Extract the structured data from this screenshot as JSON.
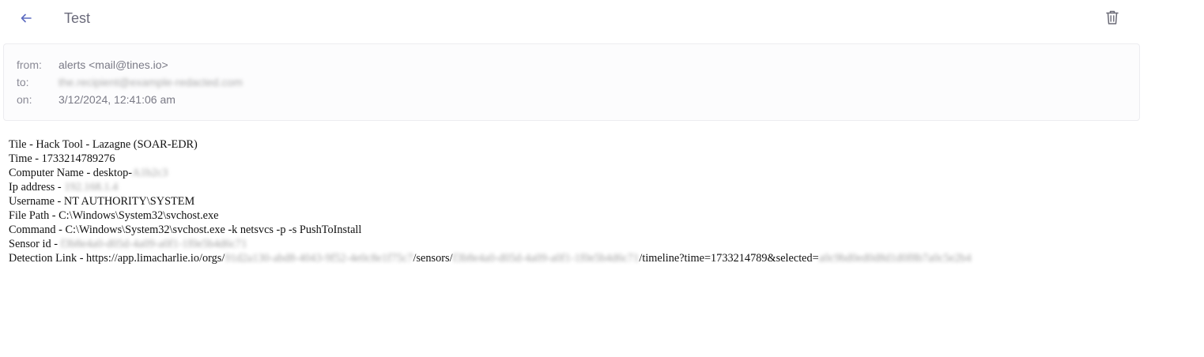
{
  "header": {
    "title": "Test",
    "back_icon": "arrow-left-icon",
    "delete_icon": "trash-icon",
    "accent_color": "#5c6bc0"
  },
  "meta": {
    "from_label": "from:",
    "from_value": "alerts <mail@tines.io>",
    "to_label": "to:",
    "to_value_redacted": "the.recipient@example-redacted.com",
    "on_label": "on:",
    "on_value": "3/12/2024, 12:41:06 am"
  },
  "body": {
    "tile": "Tile - Hack Tool - Lazagne (SOAR-EDR)",
    "time": "Time - 1733214789276",
    "computer_prefix": "Computer Name - desktop-",
    "computer_redacted": "A1b2c3",
    "ip_prefix": "Ip address - ",
    "ip_redacted": "192.168.1.4",
    "username": "Username - NT AUTHORITY\\SYSTEM",
    "file_path": "File Path - C:\\Windows\\System32\\svchost.exe",
    "command": "Command - C:\\Windows\\System32\\svchost.exe -k netsvcs -p -s PushToInstall",
    "sensor_prefix": "Sensor id - ",
    "sensor_redacted": "f3b8e4a0-d05d-4a09-a0f1-1f0e5b4d6c71",
    "link_prefix": "Detection Link - https://app.limacharlie.io/orgs/",
    "link_org_redacted": "91d2a130-abd8-4043-9f52-4e0c8e1f75c7",
    "link_sensors": "/sensors/",
    "link_sensor_redacted": "f3b8e4a0-d05d-4a09-a0f1-1f0e5b4d6c71",
    "link_suffix": "/timeline?time=1733214789&selected=",
    "link_selected_redacted": "a0c9bd0ed0d8d1d0f8b7a0c5e2b4"
  }
}
